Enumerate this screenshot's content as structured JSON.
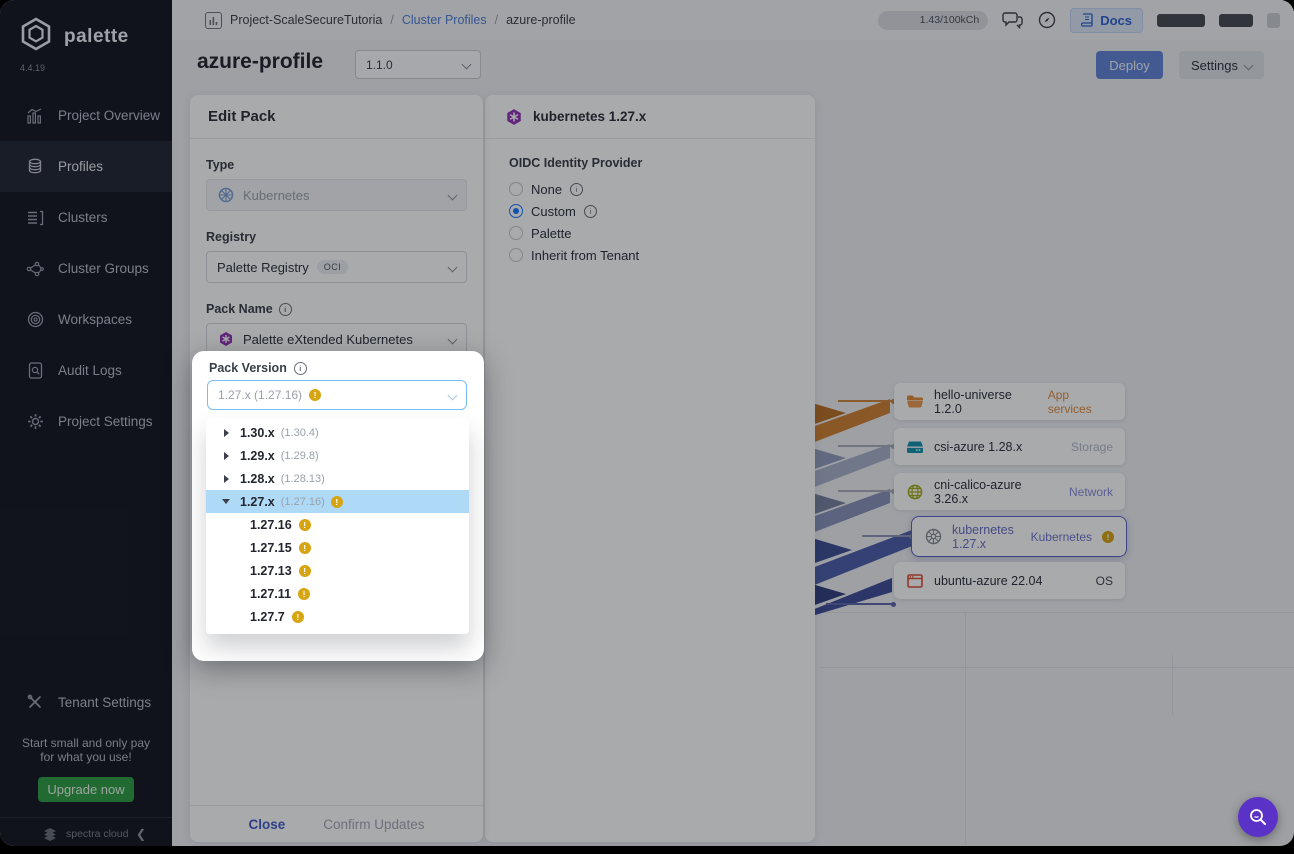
{
  "sidebar": {
    "brand": "palette",
    "version": "4.4.19",
    "items": [
      {
        "label": "Project Overview",
        "icon": "bar-chart-icon",
        "active": false
      },
      {
        "label": "Profiles",
        "icon": "database-icon",
        "active": true
      },
      {
        "label": "Clusters",
        "icon": "clusters-icon",
        "active": false
      },
      {
        "label": "Cluster Groups",
        "icon": "cluster-groups-icon",
        "active": false
      },
      {
        "label": "Workspaces",
        "icon": "workspaces-icon",
        "active": false
      },
      {
        "label": "Audit Logs",
        "icon": "audit-logs-icon",
        "active": false
      },
      {
        "label": "Project Settings",
        "icon": "gear-icon",
        "active": false
      }
    ],
    "tenant_settings_label": "Tenant Settings",
    "promo_line1": "Start small and only pay",
    "promo_line2": "for what you use!",
    "upgrade_button": "Upgrade now",
    "footer_brand": "spectra cloud"
  },
  "topbar": {
    "project": "Project-ScaleSecureTutoria",
    "breadcrumb_link": "Cluster Profiles",
    "breadcrumb_current": "azure-profile",
    "usage_badge": "1.43/100kCh",
    "docs_button": "Docs"
  },
  "header": {
    "title": "azure-profile",
    "version_select": "1.1.0",
    "deploy_button": "Deploy",
    "settings_button": "Settings"
  },
  "edit_pack": {
    "title": "Edit Pack",
    "type_label": "Type",
    "type_value": "Kubernetes",
    "registry_label": "Registry",
    "registry_value": "Palette Registry",
    "registry_badge": "OCI",
    "pack_name_label": "Pack Name",
    "pack_name_value": "Palette eXtended Kubernetes",
    "pack_version_label": "Pack Version",
    "pack_version_value": "1.27.x (1.27.16)",
    "close_button": "Close",
    "confirm_button": "Confirm Updates"
  },
  "version_tree": {
    "groups": [
      {
        "label": "1.30.x",
        "sub_label": "(1.30.4)",
        "warning": false,
        "expanded": false,
        "selected": false,
        "children": []
      },
      {
        "label": "1.29.x",
        "sub_label": "(1.29.8)",
        "warning": false,
        "expanded": false,
        "selected": false,
        "children": []
      },
      {
        "label": "1.28.x",
        "sub_label": "(1.28.13)",
        "warning": false,
        "expanded": false,
        "selected": false,
        "children": []
      },
      {
        "label": "1.27.x",
        "sub_label": "(1.27.16)",
        "warning": true,
        "expanded": true,
        "selected": true,
        "children": [
          "1.27.16",
          "1.27.15",
          "1.27.13",
          "1.27.11",
          "1.27.7"
        ]
      }
    ]
  },
  "pack_details": {
    "header": "kubernetes 1.27.x",
    "oidc_label": "OIDC Identity Provider",
    "options": [
      {
        "label": "None",
        "info": true,
        "selected": false
      },
      {
        "label": "Custom",
        "info": true,
        "selected": true
      },
      {
        "label": "Palette",
        "info": false,
        "selected": false
      },
      {
        "label": "Inherit from Tenant",
        "info": false,
        "selected": false
      }
    ]
  },
  "profile_stack": {
    "layers": [
      {
        "name": "hello-universe 1.2.0",
        "tag": "App services",
        "icon": "folder-icon",
        "tag_color": "#dd8c3e",
        "warning": false,
        "selected": false
      },
      {
        "name": "csi-azure 1.28.x",
        "tag": "Storage",
        "icon": "storage-icon",
        "tag_color": "#b3b9cf",
        "warning": false,
        "selected": false
      },
      {
        "name": "cni-calico-azure 3.26.x",
        "tag": "Network",
        "icon": "globe-icon",
        "tag_color": "#888dd8",
        "warning": false,
        "selected": false
      },
      {
        "name": "kubernetes 1.27.x",
        "tag": "Kubernetes",
        "icon": "k8s-wheel-icon",
        "tag_color": "#7276cc",
        "warning": true,
        "selected": true
      },
      {
        "name": "ubuntu-azure 22.04",
        "tag": "OS",
        "icon": "os-window-icon",
        "tag_color": "#40454f",
        "warning": false,
        "selected": false
      }
    ]
  },
  "colors": {
    "accent_blue": "#1677ff",
    "link_blue": "#4d7fd6",
    "warning_yellow": "#d7a412",
    "upgrade_green": "#2f9e44",
    "fab_purple": "#5b32c8",
    "selected_row_blue": "#aed9f7",
    "pack_version_border": "#79bdf7",
    "ribbon_colors": [
      "#d08132",
      "#a8b1ca",
      "#8793ba",
      "#4d5fa9",
      "#3f4d99"
    ]
  }
}
